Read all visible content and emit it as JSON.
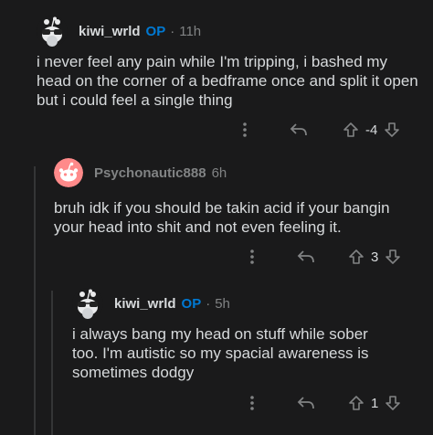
{
  "comments": [
    {
      "username": "kiwi_wrld",
      "op_badge": "OP",
      "separator": "·",
      "time": "11h",
      "avatar_icon": "snoo-avatar-glasses-icon",
      "text": "i never feel any pain while I'm tripping, i bashed my head on the corner of a bedframe once and split it open but i could feel a single thing",
      "score": "-4"
    },
    {
      "username": "Psychonautic888",
      "time": "6h",
      "avatar_icon": "snoo-avatar-default-pink-icon",
      "text": "bruh idk if you should be takin acid if your bangin your head into shit and not even feeling it.",
      "score": "3"
    },
    {
      "username": "kiwi_wrld",
      "op_badge": "OP",
      "separator": "·",
      "time": "5h",
      "avatar_icon": "snoo-avatar-glasses-icon",
      "text": "i always bang my head on stuff while sober too. I'm autistic so my spacial awareness is sometimes dodgy",
      "score": "1"
    }
  ],
  "icons": {
    "more": "more-options-icon",
    "reply": "reply-icon",
    "upvote": "upvote-icon",
    "downvote": "downvote-icon"
  },
  "colors": {
    "background": "#1a1a1b",
    "text": "#d7dadc",
    "meta": "#818384",
    "op_badge": "#0079d3",
    "thread_line": "#343536",
    "avatar_pink": "#ff8a8a"
  }
}
